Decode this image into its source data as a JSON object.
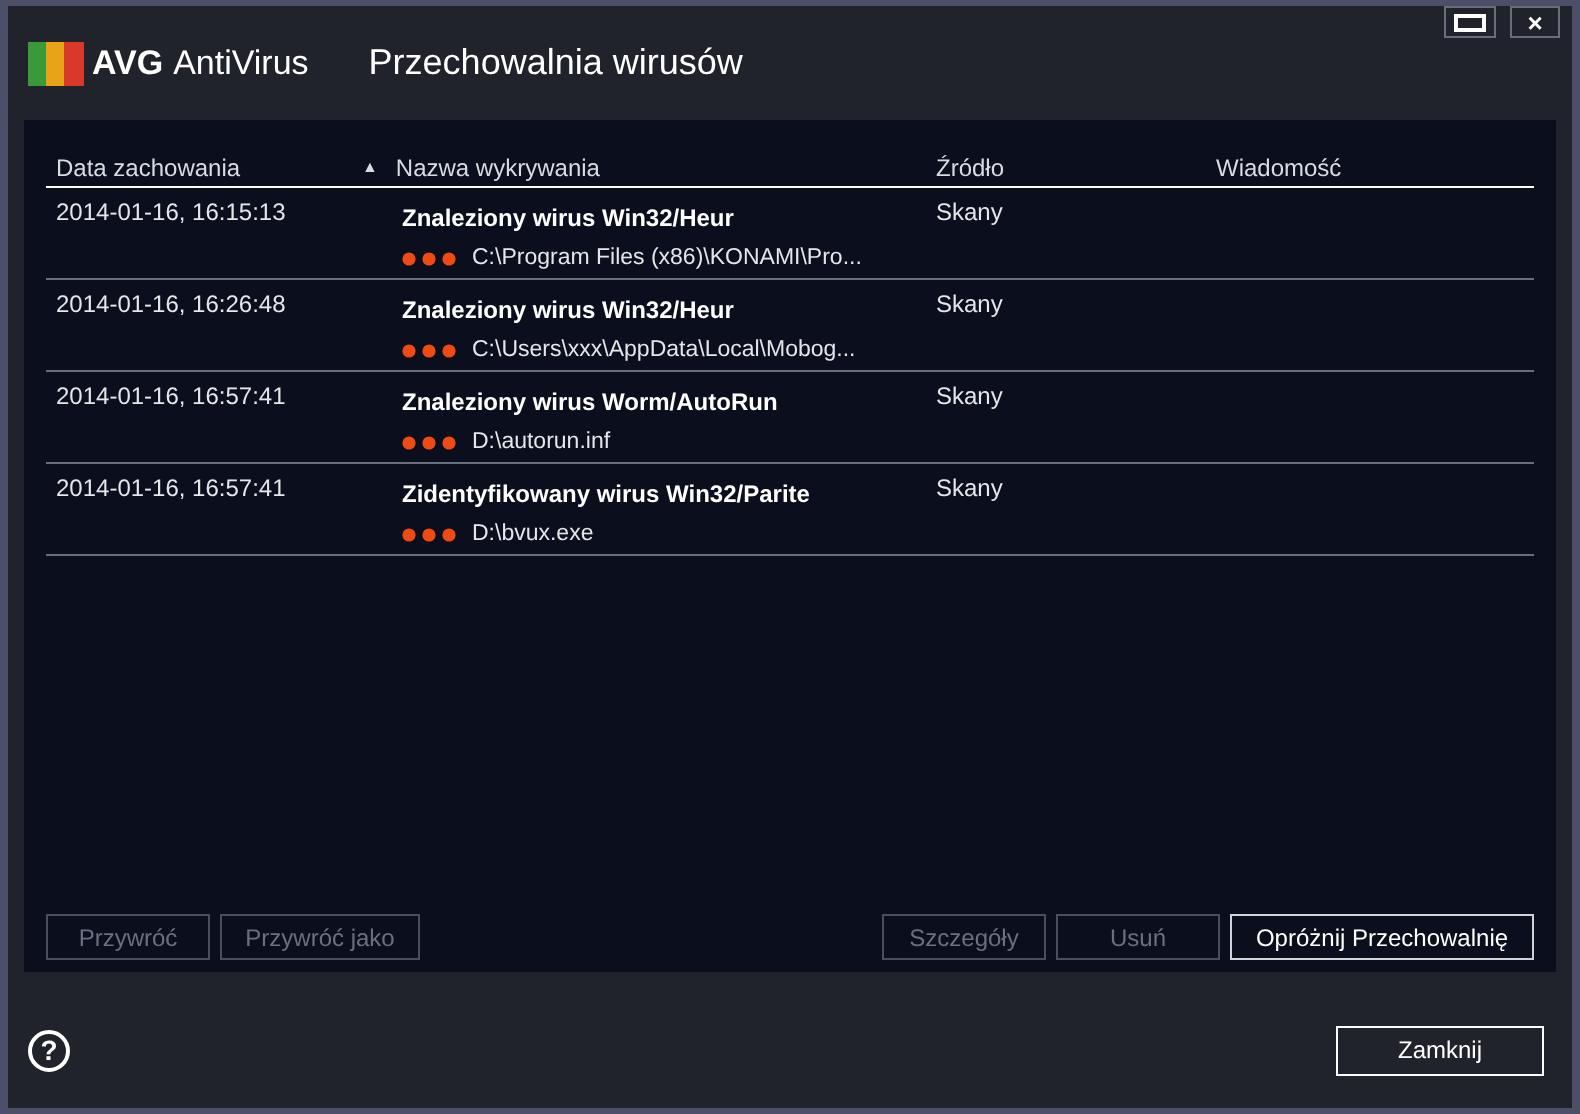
{
  "window": {
    "brand": "AVG",
    "product": "AntiVirus",
    "title": "Przechowalnia wirusów",
    "close_glyph": "×"
  },
  "table": {
    "columns": [
      {
        "label": "Data zachowania",
        "sorted": false
      },
      {
        "label": "Nazwa wykrywania",
        "sorted": true,
        "sort_glyph": "▲"
      },
      {
        "label": "Źródło",
        "sorted": false
      },
      {
        "label": "Wiadomość",
        "sorted": false
      }
    ],
    "rows": [
      {
        "date": "2014-01-16, 16:15:13",
        "name": "Znaleziony wirus Win32/Heur",
        "path": "C:\\Program Files (x86)\\KONAMI\\Pro...",
        "source": "Skany"
      },
      {
        "date": "2014-01-16, 16:26:48",
        "name": "Znaleziony wirus Win32/Heur",
        "path": "C:\\Users\\xxx\\AppData\\Local\\Mobog...",
        "source": "Skany"
      },
      {
        "date": "2014-01-16, 16:57:41",
        "name": "Znaleziony wirus Worm/AutoRun",
        "path": "D:\\autorun.inf",
        "source": "Skany"
      },
      {
        "date": "2014-01-16, 16:57:41",
        "name": "Zidentyfikowany wirus Win32/Parite",
        "path": "D:\\bvux.exe",
        "source": "Skany"
      }
    ]
  },
  "left_buttons": [
    {
      "label": "Przywróć",
      "disabled": true
    },
    {
      "label": "Przywróć jako",
      "disabled": true
    }
  ],
  "right_buttons": [
    {
      "label": "Szczegóły",
      "disabled": true
    },
    {
      "label": "Usuń",
      "disabled": true
    },
    {
      "label": "Opróżnij Przechowalnię",
      "disabled": false
    }
  ],
  "footer": {
    "help_glyph": "?",
    "close_button": "Zamknij"
  }
}
